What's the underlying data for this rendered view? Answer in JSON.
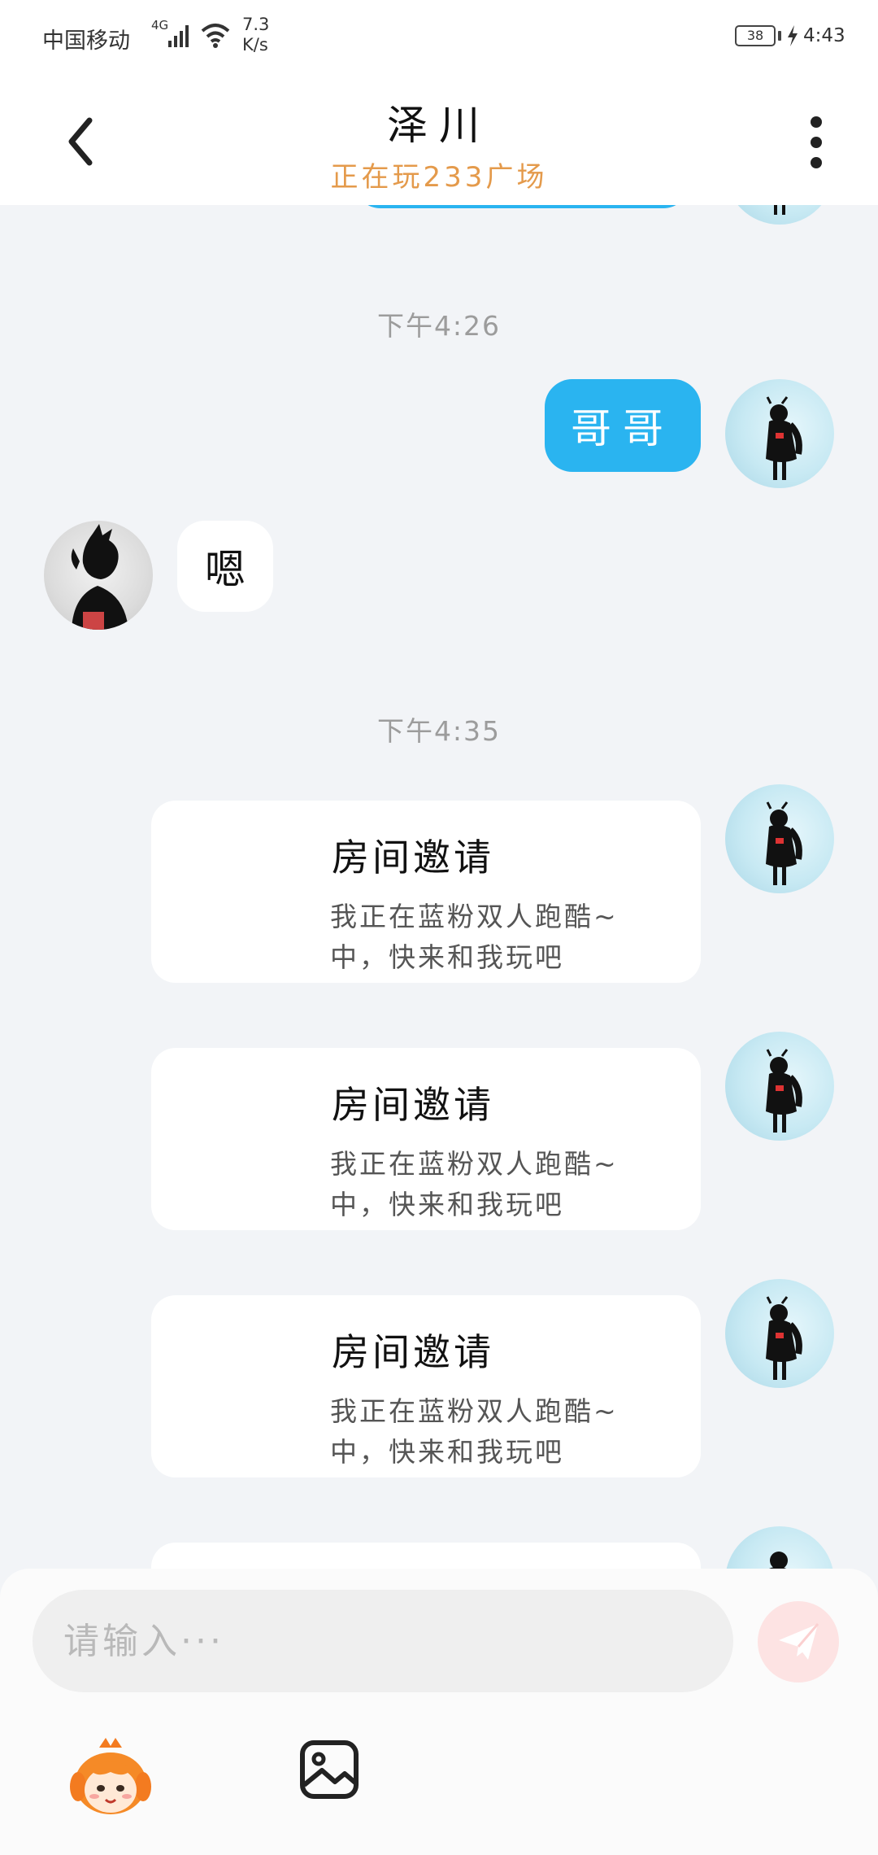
{
  "status_bar": {
    "carrier": "中国移动",
    "network": "4G",
    "speed_value": "7.3",
    "speed_unit": "K/s",
    "battery": "38",
    "time": "4:43"
  },
  "header": {
    "title": "泽川",
    "subtitle": "正在玩233广场",
    "back_icon": "chevron-left-icon",
    "more_icon": "more-vertical-icon"
  },
  "chat": {
    "timestamps": [
      "下午4:26",
      "下午4:35"
    ],
    "sent_text": "哥哥",
    "received_text": "嗯",
    "invites": [
      {
        "title": "房间邀请",
        "desc": "我正在蓝粉双人跑酷~中，快来和我玩吧"
      },
      {
        "title": "房间邀请",
        "desc": "我正在蓝粉双人跑酷~中，快来和我玩吧"
      },
      {
        "title": "房间邀请",
        "desc": "我正在蓝粉双人跑酷~中，快来和我玩吧"
      }
    ]
  },
  "composer": {
    "placeholder": "请输入···",
    "send_icon": "paper-plane-icon",
    "emoji_icon": "mascot-icon",
    "image_icon": "image-icon"
  },
  "colors": {
    "accent_blue": "#2ab4f0",
    "subtitle_orange": "#e49a4b",
    "background": "#f2f4f7",
    "send_button": "#fde3e3"
  }
}
